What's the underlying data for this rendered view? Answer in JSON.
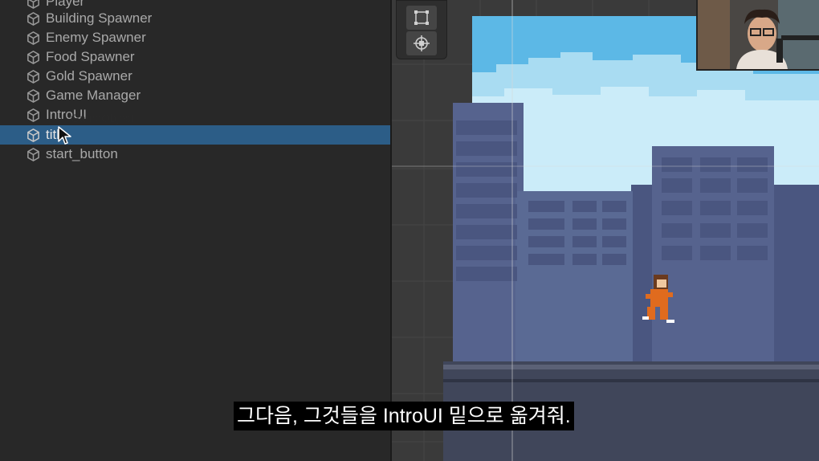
{
  "hierarchy": {
    "items": [
      {
        "label": "Player",
        "selected": false
      },
      {
        "label": "Building Spawner",
        "selected": false
      },
      {
        "label": "Enemy Spawner",
        "selected": false
      },
      {
        "label": "Food Spawner",
        "selected": false
      },
      {
        "label": "Gold Spawner",
        "selected": false
      },
      {
        "label": "Game Manager",
        "selected": false
      },
      {
        "label": "IntroUI",
        "selected": false
      },
      {
        "label": "title",
        "selected": true
      },
      {
        "label": "start_button",
        "selected": false
      }
    ],
    "drag_ghost": "GameObject"
  },
  "scene_view": {
    "tools": [
      {
        "icon": "rect-tool-icon"
      },
      {
        "icon": "transform-tool-icon"
      }
    ],
    "colors": {
      "sky": "#5cb8e6",
      "buildings": "#5a6a94",
      "ground": "#40465a"
    }
  },
  "subtitle": {
    "text": "그다음, 그것들을 IntroUI 밑으로 옮겨줘."
  },
  "colors": {
    "selection": "#2c5d87",
    "panel_bg": "#282828",
    "text": "#a9a9a9"
  }
}
